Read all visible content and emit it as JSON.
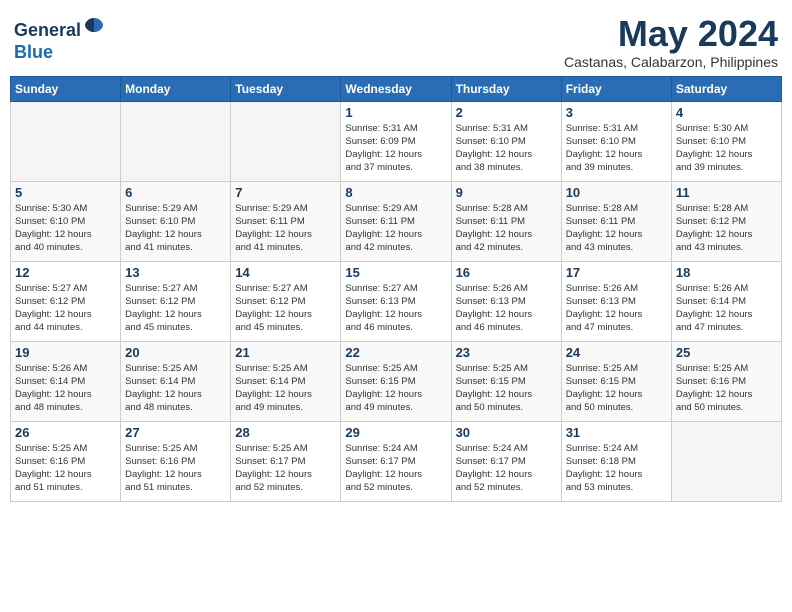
{
  "header": {
    "logo_line1": "General",
    "logo_line2": "Blue",
    "month_year": "May 2024",
    "location": "Castanas, Calabarzon, Philippines"
  },
  "days_of_week": [
    "Sunday",
    "Monday",
    "Tuesday",
    "Wednesday",
    "Thursday",
    "Friday",
    "Saturday"
  ],
  "weeks": [
    [
      {
        "day": "",
        "info": ""
      },
      {
        "day": "",
        "info": ""
      },
      {
        "day": "",
        "info": ""
      },
      {
        "day": "1",
        "info": "Sunrise: 5:31 AM\nSunset: 6:09 PM\nDaylight: 12 hours\nand 37 minutes."
      },
      {
        "day": "2",
        "info": "Sunrise: 5:31 AM\nSunset: 6:10 PM\nDaylight: 12 hours\nand 38 minutes."
      },
      {
        "day": "3",
        "info": "Sunrise: 5:31 AM\nSunset: 6:10 PM\nDaylight: 12 hours\nand 39 minutes."
      },
      {
        "day": "4",
        "info": "Sunrise: 5:30 AM\nSunset: 6:10 PM\nDaylight: 12 hours\nand 39 minutes."
      }
    ],
    [
      {
        "day": "5",
        "info": "Sunrise: 5:30 AM\nSunset: 6:10 PM\nDaylight: 12 hours\nand 40 minutes."
      },
      {
        "day": "6",
        "info": "Sunrise: 5:29 AM\nSunset: 6:10 PM\nDaylight: 12 hours\nand 41 minutes."
      },
      {
        "day": "7",
        "info": "Sunrise: 5:29 AM\nSunset: 6:11 PM\nDaylight: 12 hours\nand 41 minutes."
      },
      {
        "day": "8",
        "info": "Sunrise: 5:29 AM\nSunset: 6:11 PM\nDaylight: 12 hours\nand 42 minutes."
      },
      {
        "day": "9",
        "info": "Sunrise: 5:28 AM\nSunset: 6:11 PM\nDaylight: 12 hours\nand 42 minutes."
      },
      {
        "day": "10",
        "info": "Sunrise: 5:28 AM\nSunset: 6:11 PM\nDaylight: 12 hours\nand 43 minutes."
      },
      {
        "day": "11",
        "info": "Sunrise: 5:28 AM\nSunset: 6:12 PM\nDaylight: 12 hours\nand 43 minutes."
      }
    ],
    [
      {
        "day": "12",
        "info": "Sunrise: 5:27 AM\nSunset: 6:12 PM\nDaylight: 12 hours\nand 44 minutes."
      },
      {
        "day": "13",
        "info": "Sunrise: 5:27 AM\nSunset: 6:12 PM\nDaylight: 12 hours\nand 45 minutes."
      },
      {
        "day": "14",
        "info": "Sunrise: 5:27 AM\nSunset: 6:12 PM\nDaylight: 12 hours\nand 45 minutes."
      },
      {
        "day": "15",
        "info": "Sunrise: 5:27 AM\nSunset: 6:13 PM\nDaylight: 12 hours\nand 46 minutes."
      },
      {
        "day": "16",
        "info": "Sunrise: 5:26 AM\nSunset: 6:13 PM\nDaylight: 12 hours\nand 46 minutes."
      },
      {
        "day": "17",
        "info": "Sunrise: 5:26 AM\nSunset: 6:13 PM\nDaylight: 12 hours\nand 47 minutes."
      },
      {
        "day": "18",
        "info": "Sunrise: 5:26 AM\nSunset: 6:14 PM\nDaylight: 12 hours\nand 47 minutes."
      }
    ],
    [
      {
        "day": "19",
        "info": "Sunrise: 5:26 AM\nSunset: 6:14 PM\nDaylight: 12 hours\nand 48 minutes."
      },
      {
        "day": "20",
        "info": "Sunrise: 5:25 AM\nSunset: 6:14 PM\nDaylight: 12 hours\nand 48 minutes."
      },
      {
        "day": "21",
        "info": "Sunrise: 5:25 AM\nSunset: 6:14 PM\nDaylight: 12 hours\nand 49 minutes."
      },
      {
        "day": "22",
        "info": "Sunrise: 5:25 AM\nSunset: 6:15 PM\nDaylight: 12 hours\nand 49 minutes."
      },
      {
        "day": "23",
        "info": "Sunrise: 5:25 AM\nSunset: 6:15 PM\nDaylight: 12 hours\nand 50 minutes."
      },
      {
        "day": "24",
        "info": "Sunrise: 5:25 AM\nSunset: 6:15 PM\nDaylight: 12 hours\nand 50 minutes."
      },
      {
        "day": "25",
        "info": "Sunrise: 5:25 AM\nSunset: 6:16 PM\nDaylight: 12 hours\nand 50 minutes."
      }
    ],
    [
      {
        "day": "26",
        "info": "Sunrise: 5:25 AM\nSunset: 6:16 PM\nDaylight: 12 hours\nand 51 minutes."
      },
      {
        "day": "27",
        "info": "Sunrise: 5:25 AM\nSunset: 6:16 PM\nDaylight: 12 hours\nand 51 minutes."
      },
      {
        "day": "28",
        "info": "Sunrise: 5:25 AM\nSunset: 6:17 PM\nDaylight: 12 hours\nand 52 minutes."
      },
      {
        "day": "29",
        "info": "Sunrise: 5:24 AM\nSunset: 6:17 PM\nDaylight: 12 hours\nand 52 minutes."
      },
      {
        "day": "30",
        "info": "Sunrise: 5:24 AM\nSunset: 6:17 PM\nDaylight: 12 hours\nand 52 minutes."
      },
      {
        "day": "31",
        "info": "Sunrise: 5:24 AM\nSunset: 6:18 PM\nDaylight: 12 hours\nand 53 minutes."
      },
      {
        "day": "",
        "info": ""
      }
    ]
  ]
}
